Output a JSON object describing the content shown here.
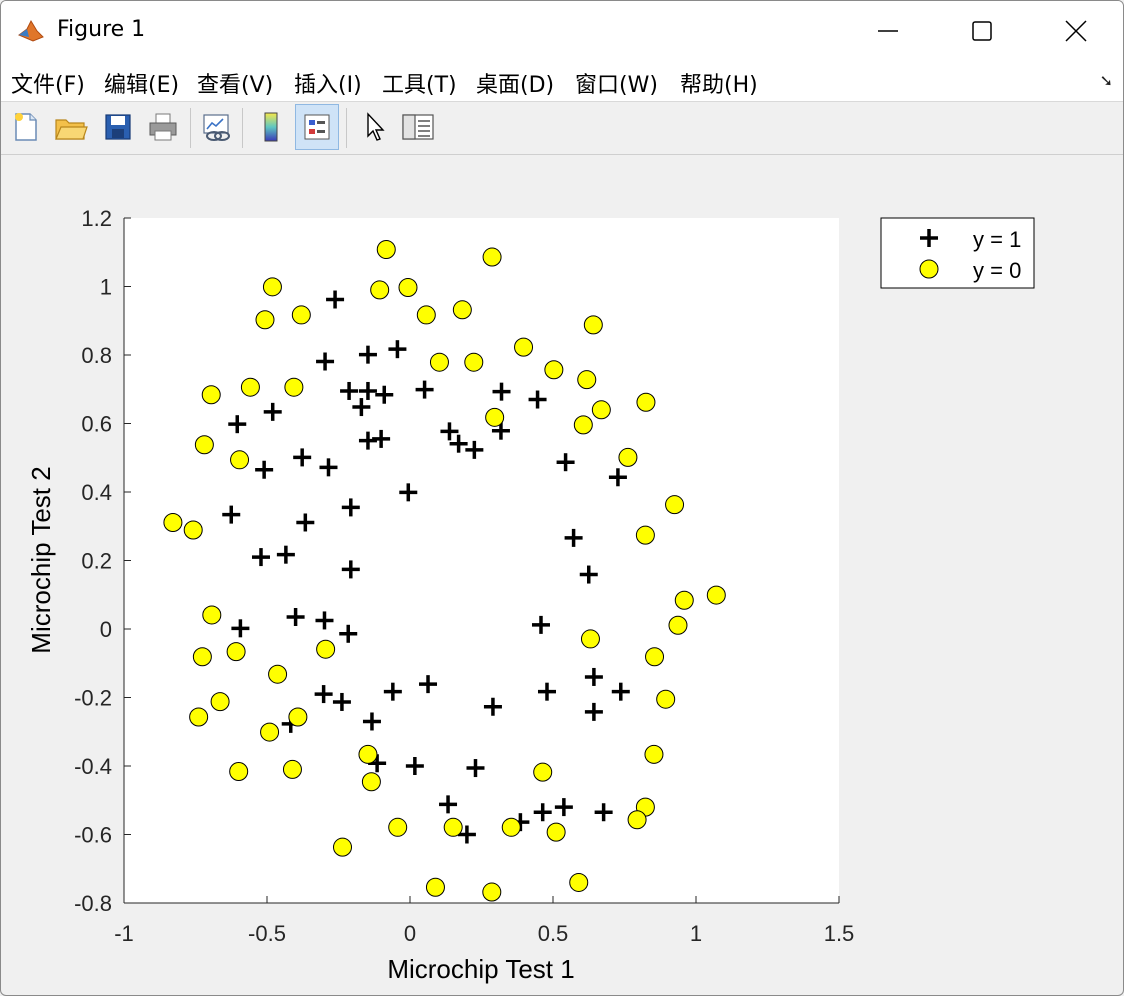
{
  "window": {
    "title": "Figure 1",
    "menus": [
      "文件(F)",
      "编辑(E)",
      "查看(V)",
      "插入(I)",
      "工具(T)",
      "桌面(D)",
      "窗口(W)",
      "帮助(H)"
    ],
    "toolbar_buttons": [
      "new-figure-icon",
      "open-file-icon",
      "save-icon",
      "print-icon",
      "link-plot-icon",
      "colorbar-icon",
      "legend-icon",
      "edit-plot-icon",
      "property-inspector-icon"
    ]
  },
  "chart_data": {
    "type": "scatter",
    "xlabel": "Microchip Test 1",
    "ylabel": "Microchip Test 2",
    "xlim": [
      -1,
      1.5
    ],
    "ylim": [
      -0.8,
      1.2
    ],
    "xticks": [
      "-1",
      "-0.5",
      "0",
      "0.5",
      "1",
      "1.5"
    ],
    "yticks": [
      "-0.8",
      "-0.6",
      "-0.4",
      "-0.2",
      "0",
      "0.2",
      "0.4",
      "0.6",
      "0.8",
      "1",
      "1.2"
    ],
    "grid": false,
    "legend_position": "outside-top-right",
    "colors": {
      "positive": "#000000",
      "negative_fill": "#ffff00",
      "negative_edge": "#000000",
      "axes_bg": "#ffffff"
    },
    "series": [
      {
        "name": "y = 1",
        "marker": "plus",
        "points": [
          [
            -0.262,
            0.962
          ],
          [
            -0.044,
            0.817
          ],
          [
            -0.147,
            0.801
          ],
          [
            -0.297,
            0.781
          ],
          [
            -0.213,
            0.695
          ],
          [
            -0.147,
            0.695
          ],
          [
            -0.09,
            0.684
          ],
          [
            0.051,
            0.699
          ],
          [
            0.32,
            0.693
          ],
          [
            0.446,
            0.67
          ],
          [
            -0.17,
            0.648
          ],
          [
            -0.48,
            0.634
          ],
          [
            -0.604,
            0.598
          ],
          [
            0.138,
            0.577
          ],
          [
            0.318,
            0.579
          ],
          [
            -0.147,
            0.55
          ],
          [
            -0.101,
            0.555
          ],
          [
            0.17,
            0.541
          ],
          [
            0.225,
            0.523
          ],
          [
            -0.377,
            0.501
          ],
          [
            -0.285,
            0.472
          ],
          [
            -0.51,
            0.465
          ],
          [
            0.544,
            0.487
          ],
          [
            0.727,
            0.443
          ],
          [
            -0.006,
            0.399
          ],
          [
            -0.207,
            0.355
          ],
          [
            -0.625,
            0.334
          ],
          [
            -0.366,
            0.311
          ],
          [
            0.572,
            0.266
          ],
          [
            -0.434,
            0.217
          ],
          [
            -0.521,
            0.21
          ],
          [
            -0.207,
            0.174
          ],
          [
            0.625,
            0.159
          ],
          [
            -0.4,
            0.035
          ],
          [
            -0.299,
            0.025
          ],
          [
            -0.593,
            0.002
          ],
          [
            -0.216,
            -0.014
          ],
          [
            0.458,
            0.012
          ],
          [
            0.643,
            -0.14
          ],
          [
            0.737,
            -0.183
          ],
          [
            0.479,
            -0.183
          ],
          [
            0.063,
            -0.161
          ],
          [
            -0.06,
            -0.183
          ],
          [
            -0.302,
            -0.19
          ],
          [
            -0.238,
            -0.213
          ],
          [
            0.29,
            -0.227
          ],
          [
            0.643,
            -0.242
          ],
          [
            -0.133,
            -0.27
          ],
          [
            -0.417,
            -0.277
          ],
          [
            -0.115,
            -0.392
          ],
          [
            0.017,
            -0.4
          ],
          [
            0.229,
            -0.406
          ],
          [
            0.133,
            -0.512
          ],
          [
            0.538,
            -0.52
          ],
          [
            0.464,
            -0.535
          ],
          [
            0.677,
            -0.535
          ],
          [
            0.386,
            -0.564
          ],
          [
            0.199,
            -0.6
          ]
        ]
      },
      {
        "name": "y = 0",
        "marker": "circle",
        "points": [
          [
            -0.083,
            1.108
          ],
          [
            0.287,
            1.086
          ],
          [
            -0.481,
            0.999
          ],
          [
            -0.106,
            0.99
          ],
          [
            -0.007,
            0.997
          ],
          [
            -0.507,
            0.903
          ],
          [
            -0.38,
            0.917
          ],
          [
            0.057,
            0.917
          ],
          [
            0.183,
            0.932
          ],
          [
            0.641,
            0.888
          ],
          [
            0.397,
            0.823
          ],
          [
            0.103,
            0.779
          ],
          [
            0.223,
            0.779
          ],
          [
            0.503,
            0.757
          ],
          [
            0.618,
            0.728
          ],
          [
            -0.558,
            0.706
          ],
          [
            -0.406,
            0.706
          ],
          [
            -0.695,
            0.684
          ],
          [
            0.825,
            0.662
          ],
          [
            0.669,
            0.64
          ],
          [
            0.296,
            0.618
          ],
          [
            0.606,
            0.596
          ],
          [
            -0.719,
            0.538
          ],
          [
            -0.596,
            0.494
          ],
          [
            0.762,
            0.501
          ],
          [
            0.925,
            0.363
          ],
          [
            -0.829,
            0.311
          ],
          [
            -0.758,
            0.289
          ],
          [
            0.823,
            0.274
          ],
          [
            1.071,
            0.099
          ],
          [
            0.959,
            0.084
          ],
          [
            -0.693,
            0.041
          ],
          [
            0.937,
            0.011
          ],
          [
            0.631,
            -0.029
          ],
          [
            -0.295,
            -0.059
          ],
          [
            -0.726,
            -0.081
          ],
          [
            -0.608,
            -0.066
          ],
          [
            0.855,
            -0.081
          ],
          [
            -0.463,
            -0.132
          ],
          [
            0.894,
            -0.205
          ],
          [
            -0.664,
            -0.212
          ],
          [
            -0.739,
            -0.257
          ],
          [
            -0.392,
            -0.257
          ],
          [
            -0.491,
            -0.301
          ],
          [
            -0.147,
            -0.366
          ],
          [
            0.853,
            -0.366
          ],
          [
            -0.599,
            -0.416
          ],
          [
            -0.411,
            -0.41
          ],
          [
            0.464,
            -0.418
          ],
          [
            -0.135,
            -0.446
          ],
          [
            0.823,
            -0.52
          ],
          [
            0.794,
            -0.557
          ],
          [
            -0.043,
            -0.579
          ],
          [
            0.151,
            -0.579
          ],
          [
            0.354,
            -0.579
          ],
          [
            0.511,
            -0.593
          ],
          [
            -0.236,
            -0.637
          ],
          [
            0.089,
            -0.754
          ],
          [
            0.286,
            -0.768
          ],
          [
            0.59,
            -0.74
          ]
        ]
      }
    ]
  }
}
